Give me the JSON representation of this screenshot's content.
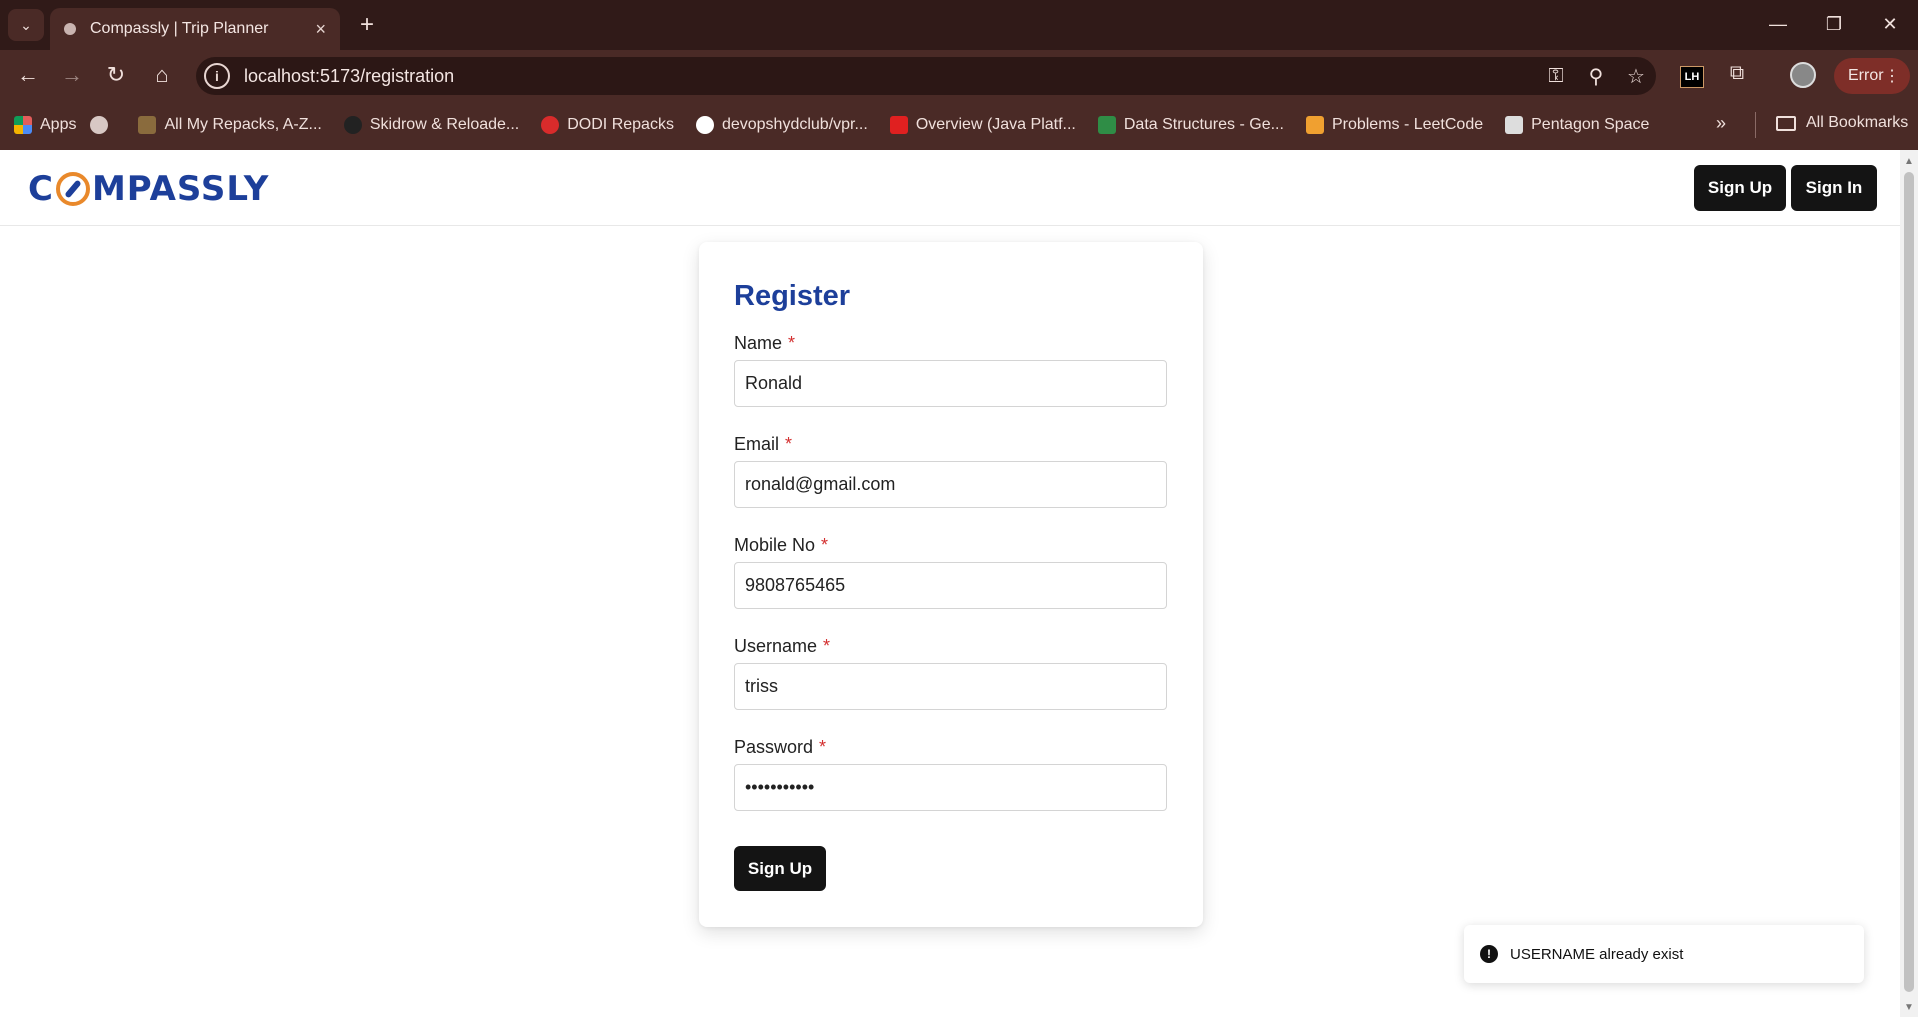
{
  "browser": {
    "tab_title": "Compassly | Trip Planner",
    "url": "localhost:5173/registration",
    "error_label": "Error",
    "bookmarks": [
      {
        "label": "Apps",
        "color": "#e35d5b"
      },
      {
        "label": "All My Repacks, A-Z...",
        "color": "#8a6b3d"
      },
      {
        "label": "Skidrow & Reloade...",
        "color": "#222222"
      },
      {
        "label": "DODI Repacks",
        "color": "#d92b2b"
      },
      {
        "label": "devopshydclub/vpr...",
        "color": "#ffffff"
      },
      {
        "label": "Overview (Java Platf...",
        "color": "#e02020"
      },
      {
        "label": "Data Structures - Ge...",
        "color": "#2f8d46"
      },
      {
        "label": "Problems - LeetCode",
        "color": "#f0a030"
      },
      {
        "label": "Pentagon Space",
        "color": "#dddddd"
      }
    ],
    "all_bookmarks": "All Bookmarks"
  },
  "header": {
    "logo_left": "C",
    "logo_right": "MPASSLY",
    "signup_label": "Sign Up",
    "signin_label": "Sign In"
  },
  "form": {
    "title": "Register",
    "required_mark": "*",
    "fields": {
      "name": {
        "label": "Name",
        "value": "Ronald"
      },
      "email": {
        "label": "Email",
        "value": "ronald@gmail.com"
      },
      "mobile": {
        "label": "Mobile No",
        "value": "9808765465"
      },
      "username": {
        "label": "Username",
        "value": "triss"
      },
      "password": {
        "label": "Password",
        "value": "•••••••••••"
      }
    },
    "submit_label": "Sign Up"
  },
  "toast": {
    "message": "USERNAME already exist"
  },
  "colors": {
    "brand_blue": "#1d3f9a",
    "brand_orange": "#e9892b",
    "chrome_bg": "#4a2a26",
    "button_dark": "#141414",
    "required_red": "#d32f2f"
  }
}
